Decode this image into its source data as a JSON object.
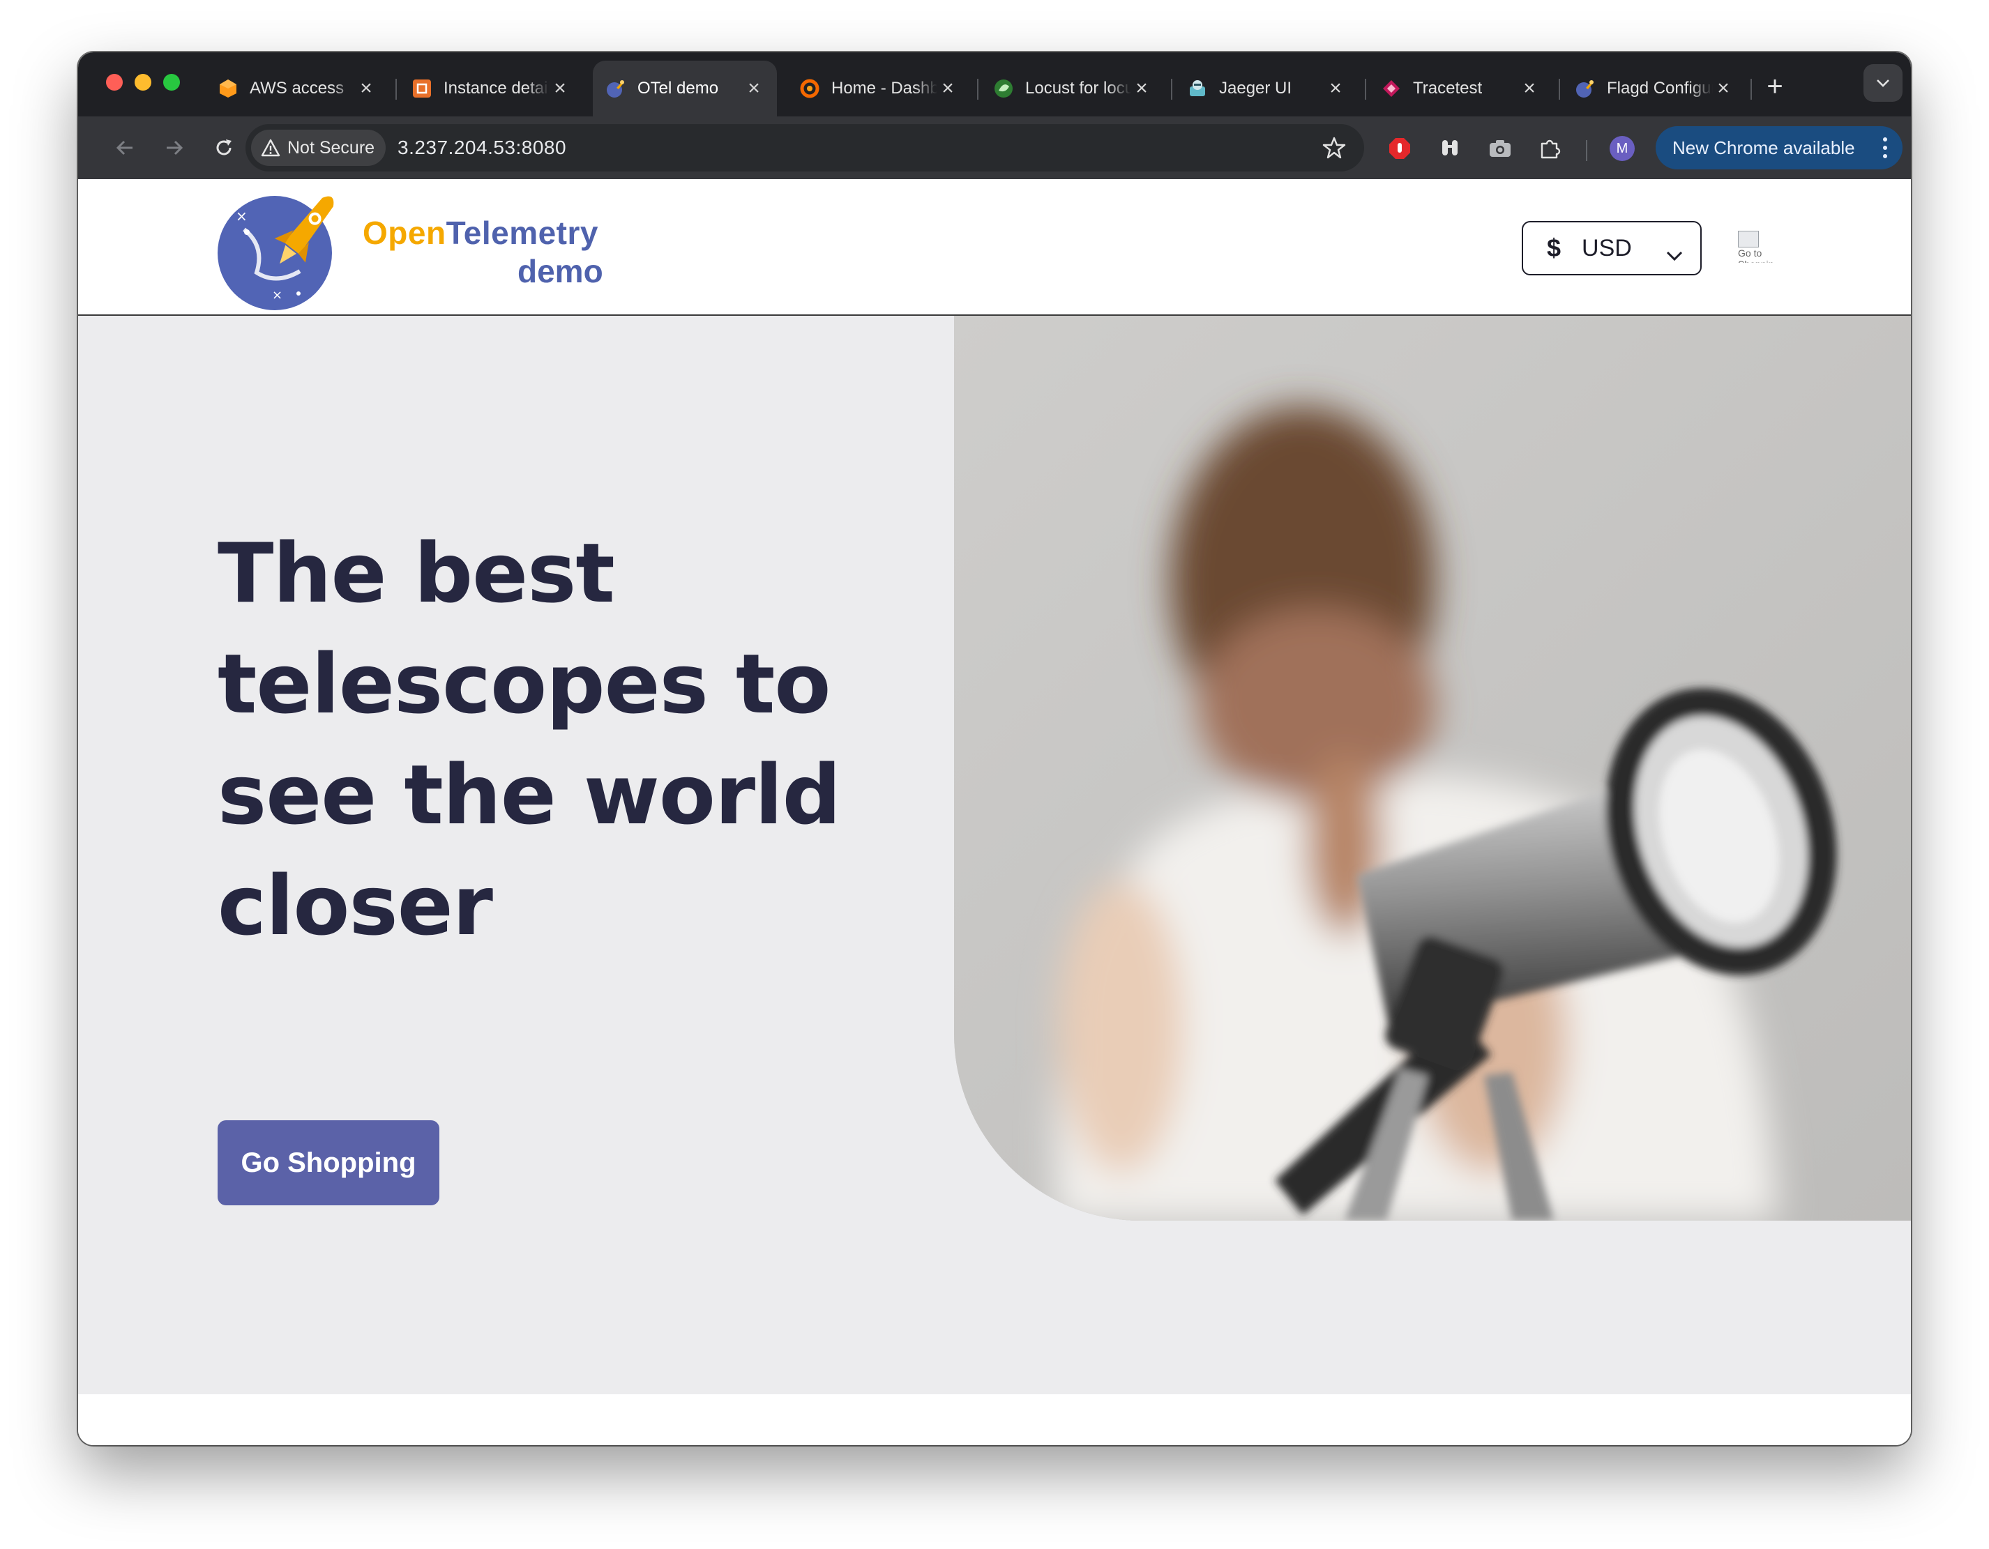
{
  "browser": {
    "tabs": [
      {
        "title": "AWS access",
        "favicon": "aws-icon",
        "active": false
      },
      {
        "title": "Instance details",
        "favicon": "ec2-icon",
        "active": false
      },
      {
        "title": "OTel demo",
        "favicon": "otel-icon",
        "active": true
      },
      {
        "title": "Home - Dashboards",
        "favicon": "grafana-icon",
        "active": false
      },
      {
        "title": "Locust for locustfile",
        "favicon": "locust-icon",
        "active": false
      },
      {
        "title": "Jaeger UI",
        "favicon": "jaeger-icon",
        "active": false
      },
      {
        "title": "Tracetest",
        "favicon": "tracetest-icon",
        "active": false
      },
      {
        "title": "Flagd Configurator",
        "favicon": "otel-icon",
        "active": false
      }
    ],
    "security_label": "Not Secure",
    "url": "3.237.204.53:8080",
    "profile_initial": "M",
    "update_label": "New Chrome available"
  },
  "site": {
    "brand_open": "Open",
    "brand_telemetry": "Telemetry",
    "brand_demo": "demo",
    "currency": {
      "symbol": "$",
      "code": "USD"
    },
    "cart_alt": "Go to Shopping Cart"
  },
  "hero": {
    "headline": "The best telescopes to see the world closer",
    "cta_label": "Go Shopping",
    "colors": {
      "headline": "#262740",
      "cta_background": "#5b62a8",
      "hero_background": "#ececee"
    }
  }
}
